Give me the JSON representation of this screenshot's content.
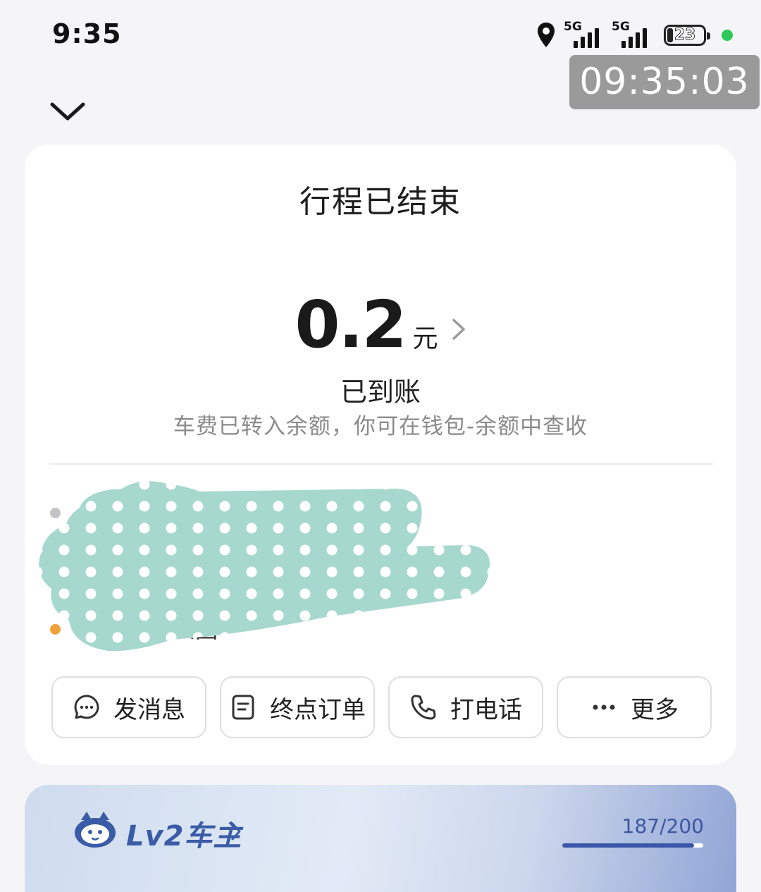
{
  "status_bar": {
    "time": "9:35",
    "network_1": "5G",
    "network_2": "5G",
    "battery": "23"
  },
  "clock_overlay": "09:35:03",
  "trip": {
    "title": "行程已结束",
    "amount": "0.2",
    "unit": "元",
    "status": "已到账",
    "hint": "车费已转入余额，你可在钱包-余额中查收",
    "end_address_fragment": "公园"
  },
  "actions": [
    {
      "label": "发消息",
      "icon": "message-icon"
    },
    {
      "label": "终点订单",
      "icon": "order-icon"
    },
    {
      "label": "打电话",
      "icon": "phone-icon"
    },
    {
      "label": "更多",
      "icon": "more-icon"
    }
  ],
  "level": {
    "title": "Lv2车主",
    "progress_text": "187/200",
    "progress_fraction": 0.935
  },
  "colors": {
    "redaction": "#a6d8ce",
    "end_dot": "#f0a23a",
    "accent": "#3a56a8"
  }
}
